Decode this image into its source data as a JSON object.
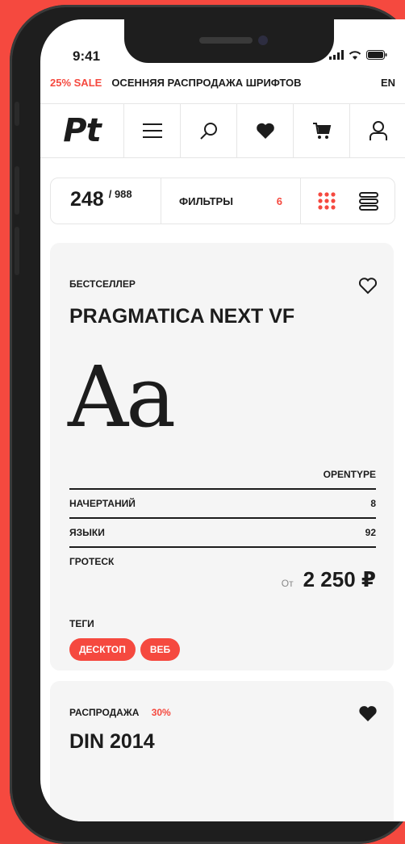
{
  "status": {
    "time": "9:41"
  },
  "sale_bar": {
    "percent": "25% SALE",
    "text": "ОСЕННЯЯ РАСПРОДАЖА ШРИФТОВ",
    "lang": "EN"
  },
  "nav": {
    "logo": "Pt"
  },
  "filters": {
    "count": "248",
    "total": "/ 988",
    "label": "ФИЛЬТРЫ",
    "active": "6"
  },
  "cards": [
    {
      "badge": "БЕСТСЕЛЛЕР",
      "title": "PRAGMATICA NEXT VF",
      "specimen": "Aa",
      "format": "OPENTYPE",
      "rows": [
        {
          "label": "НАЧЕРТАНИЙ",
          "value": "8"
        },
        {
          "label": "ЯЗЫКИ",
          "value": "92"
        },
        {
          "label": "ГРОТЕСК",
          "value": ""
        }
      ],
      "price_from": "От",
      "price": "2 250 ₽",
      "tags_label": "ТЕГИ",
      "tags": [
        "ДЕСКТОП",
        "ВЕБ"
      ],
      "favorite": false
    },
    {
      "badge": "РАСПРОДАЖА",
      "discount": "30%",
      "title": "DIN 2014",
      "favorite": true
    }
  ],
  "colors": {
    "accent": "#f5493f",
    "text": "#1c1c1c",
    "card_bg": "#f5f5f5"
  }
}
